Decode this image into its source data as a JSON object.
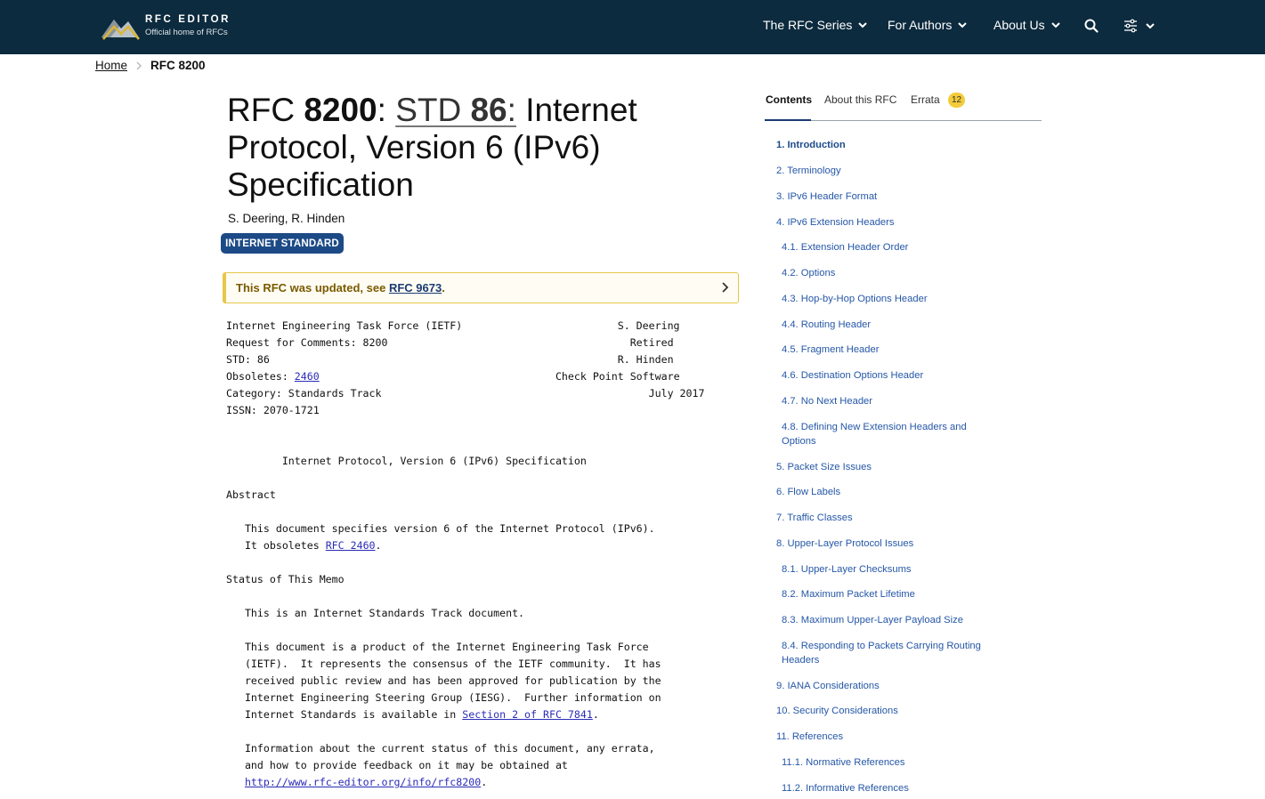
{
  "header": {
    "logo_title": "RFC EDITOR",
    "logo_subtitle": "Official home of RFCs",
    "nav": [
      {
        "label": "The RFC Series"
      },
      {
        "label": "For Authors"
      },
      {
        "label": "About Us"
      }
    ],
    "search_icon": "search-icon",
    "settings_icon": "sliders-icon"
  },
  "breadcrumb": {
    "home": "Home",
    "current": "RFC 8200"
  },
  "title": {
    "prefix": "RFC ",
    "number": "8200",
    "colon1": ": ",
    "std_prefix": "STD ",
    "std_number": "86",
    "colon2": ":",
    "rest": " Internet Protocol, Version 6 (IPv6) Specification"
  },
  "authors": "S. Deering,  R. Hinden",
  "status_badge": "INTERNET STANDARD",
  "notice": {
    "text": "This RFC was updated, see ",
    "link_prefix": "RFC ",
    "link_number": "9673",
    "suffix": "."
  },
  "rfc": {
    "header_lines": [
      "Internet Engineering Task Force (IETF)                         S. Deering",
      "Request for Comments: 8200                                       Retired",
      "STD: 86                                                        R. Hinden",
      "Obsoletes: ",
      "Category: Standards Track                                           July 2017",
      "ISSN: 2070-1721"
    ],
    "obsoletes_link": "2460",
    "obsoletes_right": "                                      Check Point Software",
    "doc_title": "         Internet Protocol, Version 6 (IPv6) Specification",
    "abstract_heading": "Abstract",
    "abstract_1": "   This document specifies version 6 of the Internet Protocol (IPv6).",
    "abstract_2_pre": "   It obsoletes ",
    "abstract_2_link": "RFC 2460",
    "abstract_2_post": ".",
    "status_heading": "Status of This Memo",
    "status_1": "   This is an Internet Standards Track document.",
    "status_2a": "   This document is a product of the Internet Engineering Task Force",
    "status_2b": "   (IETF).  It represents the consensus of the IETF community.  It has",
    "status_2c": "   received public review and has been approved for publication by the",
    "status_2d": "   Internet Engineering Steering Group (IESG).  Further information on",
    "status_2e_pre": "   Internet Standards is available in ",
    "status_2e_link": "Section 2 of RFC 7841",
    "status_2e_post": ".",
    "status_3a": "   Information about the current status of this document, any errata,",
    "status_3b": "   and how to provide feedback on it may be obtained at",
    "status_3c_pre": "   ",
    "status_3c_link": "http://www.rfc-editor.org/info/rfc8200",
    "status_3c_post": "."
  },
  "sidebar": {
    "tabs": [
      {
        "label": "Contents"
      },
      {
        "label": "About this RFC"
      },
      {
        "label": "Errata"
      }
    ],
    "errata_count": "12",
    "toc": [
      {
        "label": "1. Introduction"
      },
      {
        "label": "2. Terminology"
      },
      {
        "label": "3. IPv6 Header Format"
      },
      {
        "label": "4. IPv6 Extension Headers"
      },
      {
        "label": "4.1. Extension Header Order"
      },
      {
        "label": "4.2. Options"
      },
      {
        "label": "4.3. Hop-by-Hop Options Header"
      },
      {
        "label": "4.4. Routing Header"
      },
      {
        "label": "4.5. Fragment Header"
      },
      {
        "label": "4.6. Destination Options Header"
      },
      {
        "label": "4.7. No Next Header"
      },
      {
        "label": "4.8. Defining New Extension Headers and Options"
      },
      {
        "label": "5. Packet Size Issues"
      },
      {
        "label": "6. Flow Labels"
      },
      {
        "label": "7. Traffic Classes"
      },
      {
        "label": "8. Upper-Layer Protocol Issues"
      },
      {
        "label": "8.1. Upper-Layer Checksums"
      },
      {
        "label": "8.2. Maximum Packet Lifetime"
      },
      {
        "label": "8.3. Maximum Upper-Layer Payload Size"
      },
      {
        "label": "8.4. Responding to Packets Carrying Routing Headers"
      },
      {
        "label": "9. IANA Considerations"
      },
      {
        "label": "10. Security Considerations"
      },
      {
        "label": "11. References"
      },
      {
        "label": "11.1. Normative References"
      },
      {
        "label": "11.2. Informative References"
      }
    ]
  },
  "colors": {
    "topbar": "#0d2b3e",
    "badge": "#1c4a86",
    "link": "#2557a7",
    "notice_border": "#e8c64a",
    "errata_badge": "#f3cc3b"
  }
}
